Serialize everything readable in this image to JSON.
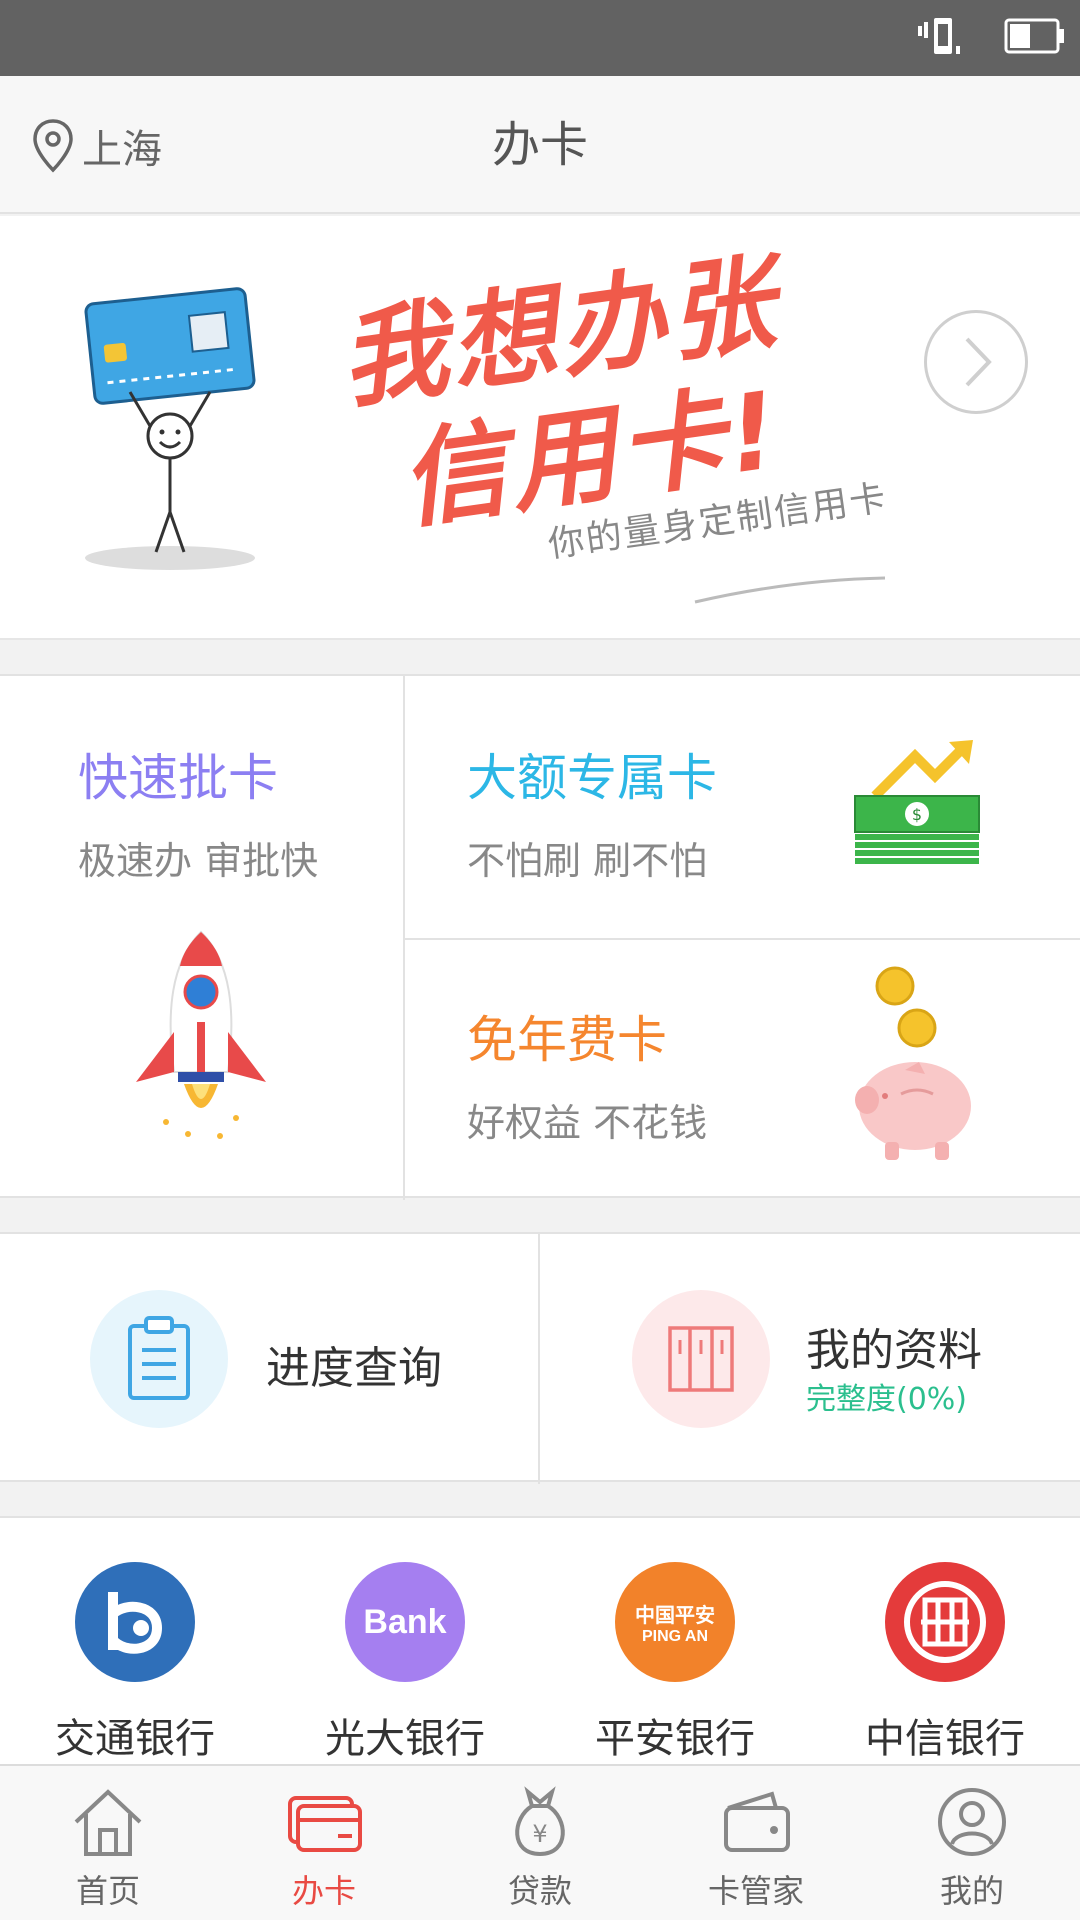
{
  "location": {
    "city": "上海"
  },
  "header": {
    "title": "办卡"
  },
  "banner": {
    "title_line1": "我想办张",
    "title_line2": "信用卡!",
    "subtitle": "你的量身定制信用卡"
  },
  "features": [
    {
      "title": "快速批卡",
      "desc": "极速办 审批快",
      "color": "#8c7ff2"
    },
    {
      "title": "大额专属卡",
      "desc": "不怕刷 刷不怕",
      "color": "#2cb7e6"
    },
    {
      "title": "免年费卡",
      "desc": "好权益 不花钱",
      "color": "#f5862e"
    }
  ],
  "quick": {
    "progress": {
      "label": "进度查询"
    },
    "profile": {
      "label": "我的资料",
      "sub": "完整度(0%)"
    }
  },
  "banks": [
    {
      "name": "交通银行",
      "icon": "bocom-logo-icon",
      "color": "#2f6fb9"
    },
    {
      "name": "光大银行",
      "icon": "ceb-logo-icon",
      "logo_text": "Bank",
      "color": "#a57ff0"
    },
    {
      "name": "平安银行",
      "icon": "pingan-logo-icon",
      "logo_text_cn": "中国平安",
      "logo_text_en": "PING AN",
      "color": "#f2822a"
    },
    {
      "name": "中信银行",
      "icon": "citic-logo-icon",
      "color": "#e43b3b"
    }
  ],
  "tabs": [
    {
      "label": "首页",
      "icon": "home-icon",
      "active": false
    },
    {
      "label": "办卡",
      "icon": "card-icon",
      "active": true
    },
    {
      "label": "贷款",
      "icon": "money-bag-icon",
      "active": false
    },
    {
      "label": "卡管家",
      "icon": "wallet-icon",
      "active": false
    },
    {
      "label": "我的",
      "icon": "user-icon",
      "active": false
    }
  ],
  "colors": {
    "accent": "#e94a43",
    "banner_red": "#f05a4a"
  }
}
